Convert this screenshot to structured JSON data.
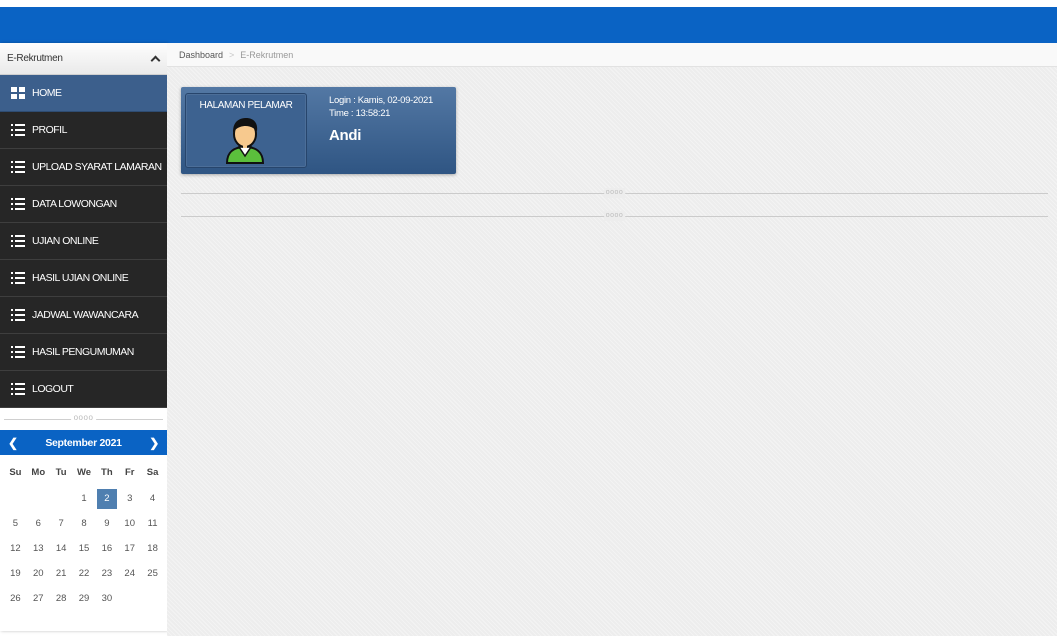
{
  "colors": {
    "topbar": "#0a63c4",
    "sidebar_bg": "#262626",
    "active_item": "#3c5f8c",
    "card": "#3b618f"
  },
  "sidebar": {
    "title": "E-Rekrutmen",
    "toggle_icon": "chevron-up-icon",
    "items": [
      {
        "label": "HOME",
        "icon": "grid-icon",
        "active": true
      },
      {
        "label": "PROFIL",
        "icon": "list-icon"
      },
      {
        "label": "UPLOAD SYARAT LAMARAN",
        "icon": "list-icon"
      },
      {
        "label": "DATA LOWONGAN",
        "icon": "list-icon"
      },
      {
        "label": "UJIAN ONLINE",
        "icon": "list-icon"
      },
      {
        "label": "HASIL UJIAN ONLINE",
        "icon": "list-icon"
      },
      {
        "label": "JADWAL WAWANCARA",
        "icon": "list-icon"
      },
      {
        "label": "HASIL PENGUMUMAN",
        "icon": "list-icon"
      },
      {
        "label": "LOGOUT",
        "icon": "list-icon"
      }
    ],
    "divider_text": "oooo"
  },
  "calendar": {
    "month_label": "September 2021",
    "weekdays": [
      "Su",
      "Mo",
      "Tu",
      "We",
      "Th",
      "Fr",
      "Sa"
    ],
    "days": [
      "",
      "",
      "",
      "1",
      "2",
      "3",
      "4",
      "5",
      "6",
      "7",
      "8",
      "9",
      "10",
      "11",
      "12",
      "13",
      "14",
      "15",
      "16",
      "17",
      "18",
      "19",
      "20",
      "21",
      "22",
      "23",
      "24",
      "25",
      "26",
      "27",
      "28",
      "29",
      "30",
      "",
      ""
    ],
    "selected_day": "2"
  },
  "breadcrumb": {
    "items": [
      "Dashboard",
      "E-Rekrutmen"
    ],
    "separator": ">"
  },
  "user_card": {
    "photo_title": "HALAMAN PELAMAR",
    "login": "Login : Kamis, 02-09-2021",
    "time": "Time : 13:58:21",
    "username": "Andi"
  },
  "separators": [
    "oooo",
    "oooo"
  ]
}
